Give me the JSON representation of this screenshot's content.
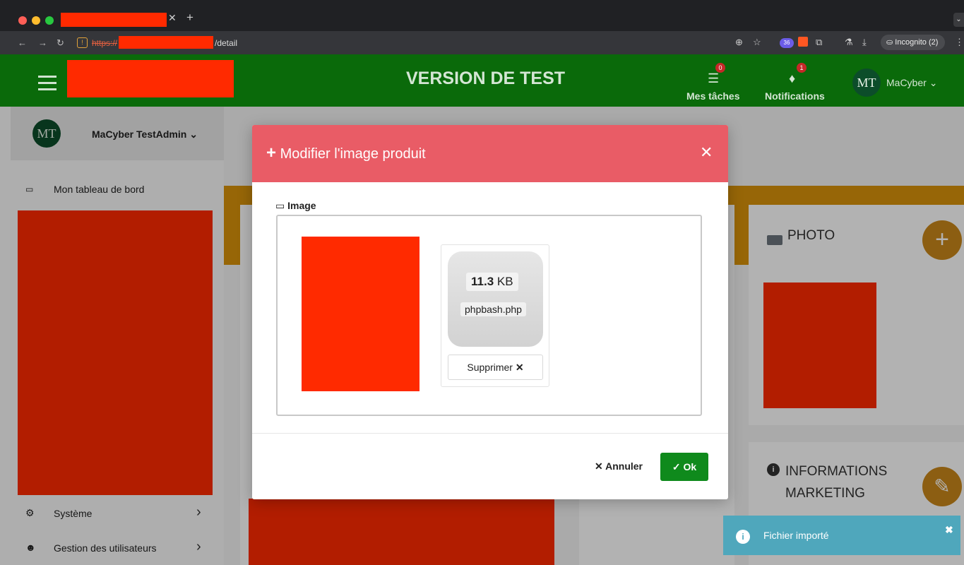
{
  "browser": {
    "url_scheme": "https://",
    "url_path": "/detail",
    "incognito_label": "Incognito (2)",
    "extension_badge": "36"
  },
  "header": {
    "title": "VERSION DE TEST",
    "tasks": {
      "label": "Mes tâches",
      "badge": "0"
    },
    "notifications": {
      "label": "Notifications",
      "badge": "1"
    },
    "user": {
      "initials": "MT",
      "name": "MaCyber"
    }
  },
  "sidebar": {
    "user": {
      "initials": "MT",
      "name": "MaCyber TestAdmin"
    },
    "items": [
      {
        "label": "Mon tableau de bord"
      },
      {
        "label": "Système"
      },
      {
        "label": "Gestion des utilisateurs"
      }
    ]
  },
  "cards": {
    "photo": {
      "title": "PHOTO"
    },
    "info": {
      "title": "INFORMATIONS MARKETING"
    }
  },
  "modal": {
    "title": "Modifier l'image produit",
    "field_label": "Image",
    "file": {
      "size_value": "11.3",
      "size_unit": "KB",
      "name": "phpbash.php"
    },
    "remove_label": "Supprimer",
    "cancel_label": "Annuler",
    "ok_label": "Ok"
  },
  "toast": {
    "message": "Fichier importé"
  },
  "colors": {
    "header_green": "#0a6a0a",
    "modal_header": "#e95c66",
    "ok_green": "#0f8a1c",
    "accent_orange": "#d9930b",
    "toast_blue": "#4aa7bd",
    "redaction": "#ff2a00"
  }
}
